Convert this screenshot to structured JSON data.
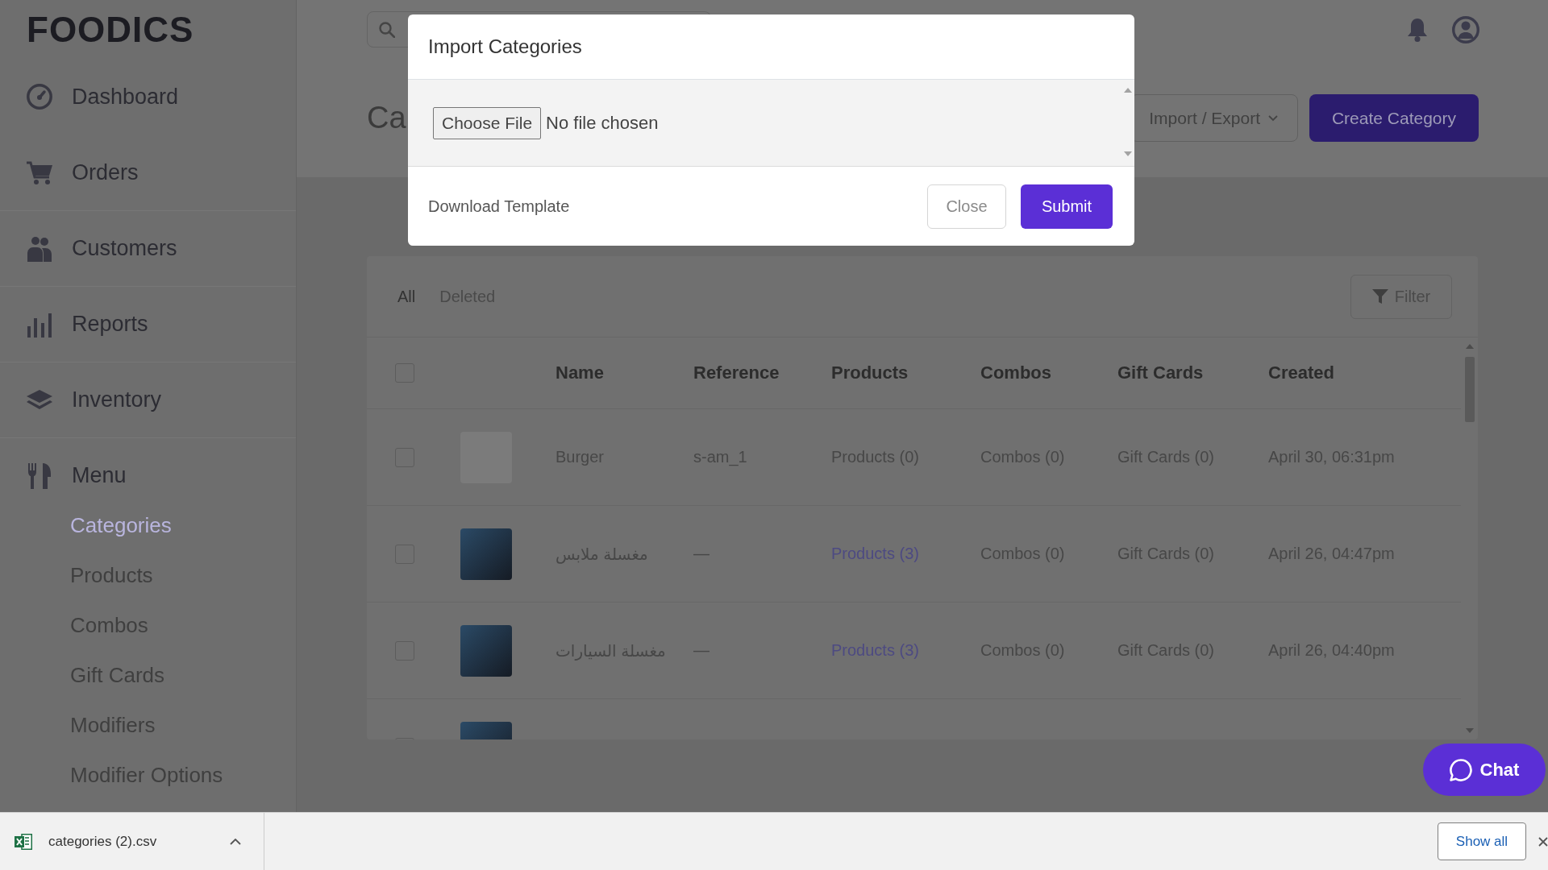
{
  "sidebar": {
    "logo": "FOODICS",
    "items": [
      {
        "label": "Dashboard"
      },
      {
        "label": "Orders"
      },
      {
        "label": "Customers"
      },
      {
        "label": "Reports"
      },
      {
        "label": "Inventory"
      },
      {
        "label": "Menu",
        "children": [
          {
            "label": "Categories",
            "selected": true
          },
          {
            "label": "Products",
            "selected": false
          },
          {
            "label": "Combos",
            "selected": false
          },
          {
            "label": "Gift Cards",
            "selected": false
          },
          {
            "label": "Modifiers",
            "selected": false
          },
          {
            "label": "Modifier Options",
            "selected": false
          }
        ]
      }
    ]
  },
  "page": {
    "title": "Ca",
    "buttons": [
      {
        "label": "Import / Export",
        "kind": "dropdown"
      },
      {
        "label": "Create Category",
        "kind": "primary"
      }
    ]
  },
  "tabs": [
    {
      "label": "All",
      "selected": true
    },
    {
      "label": "Deleted",
      "selected": false
    }
  ],
  "filter_button": "Filter",
  "table": {
    "select_all_checked": false,
    "columns": [
      "Name",
      "Reference",
      "Products",
      "Combos",
      "Gift Cards",
      "Created"
    ],
    "rows": [
      {
        "checked": false,
        "photo": false,
        "cells": [
          {
            "text": "Burger",
            "link": false
          },
          {
            "text": "s-am_1",
            "link": false
          },
          {
            "text": "Products (0)",
            "link": false
          },
          {
            "text": "Combos (0)",
            "link": false
          },
          {
            "text": "Gift Cards (0)",
            "link": false
          },
          {
            "text": "April 30, 06:31pm",
            "link": false
          }
        ]
      },
      {
        "checked": false,
        "photo": true,
        "cells": [
          {
            "text": "مغسلة ملابس",
            "link": false
          },
          {
            "text": "—",
            "link": false
          },
          {
            "text": "Products (3)",
            "link": true
          },
          {
            "text": "Combos (0)",
            "link": false
          },
          {
            "text": "Gift Cards (0)",
            "link": false
          },
          {
            "text": "April 26, 04:47pm",
            "link": false
          }
        ]
      },
      {
        "checked": false,
        "photo": true,
        "cells": [
          {
            "text": "مغسلة السيارات",
            "link": false
          },
          {
            "text": "—",
            "link": false
          },
          {
            "text": "Products (3)",
            "link": true
          },
          {
            "text": "Combos (0)",
            "link": false
          },
          {
            "text": "Gift Cards (0)",
            "link": false
          },
          {
            "text": "April 26, 04:40pm",
            "link": false
          }
        ]
      },
      {
        "checked": false,
        "photo": true
      }
    ]
  },
  "modal": {
    "title": "Import Categories",
    "file_button": "Choose File",
    "file_status": "No file chosen",
    "template_link": "Download Template",
    "buttons": [
      {
        "label": "Close",
        "kind": "secondary"
      },
      {
        "label": "Submit",
        "kind": "primary"
      }
    ]
  },
  "chat_button": "Chat",
  "download_bar": {
    "file_name": "categories (2).csv",
    "show_all": "Show all"
  }
}
